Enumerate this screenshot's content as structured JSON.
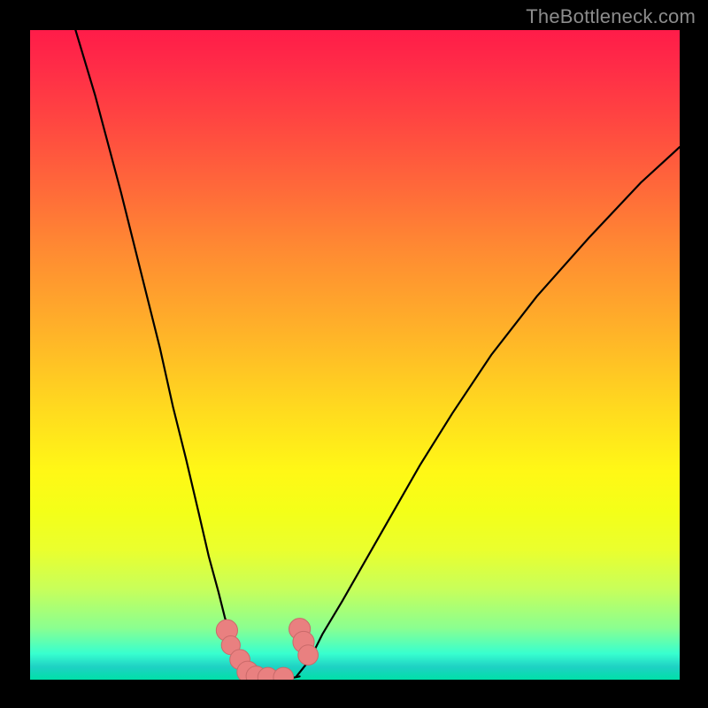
{
  "watermark": "TheBottleneck.com",
  "colors": {
    "frame": "#000000",
    "curve": "#000000",
    "dot_fill": "#e98080",
    "dot_stroke": "#ca6a6a"
  },
  "chart_data": {
    "type": "line",
    "title": "",
    "xlabel": "",
    "ylabel": "",
    "xlim": [
      0,
      100
    ],
    "ylim": [
      0,
      100
    ],
    "grid": false,
    "legend": false,
    "series": [
      {
        "name": "left-curve",
        "x": [
          7,
          10,
          14,
          17,
          20,
          22,
          24,
          26,
          27.5,
          29,
          30,
          31,
          32,
          33,
          34,
          35,
          36
        ],
        "y": [
          100,
          90,
          75,
          63,
          51,
          42,
          34,
          25.5,
          19,
          13.5,
          9.5,
          6.8,
          4.6,
          3.0,
          2.0,
          1.2,
          0.6
        ]
      },
      {
        "name": "right-curve",
        "x": [
          41,
          43,
          45,
          48,
          52,
          56,
          60,
          65,
          71,
          78,
          86,
          94,
          100
        ],
        "y": [
          0.5,
          3,
          7,
          12,
          19,
          26,
          33,
          41,
          50,
          59,
          68,
          76.5,
          82
        ]
      },
      {
        "name": "bottom-segment",
        "x": [
          32.5,
          34,
          36,
          38,
          40,
          41.5
        ],
        "y": [
          0.5,
          0.2,
          0.15,
          0.15,
          0.2,
          0.5
        ]
      }
    ],
    "markers": [
      {
        "x": 30.3,
        "y": 7.6,
        "r": 1.1
      },
      {
        "x": 30.9,
        "y": 5.3,
        "r": 0.9
      },
      {
        "x": 32.3,
        "y": 3.1,
        "r": 1.0
      },
      {
        "x": 33.5,
        "y": 1.2,
        "r": 1.1
      },
      {
        "x": 34.8,
        "y": 0.55,
        "r": 1.0
      },
      {
        "x": 36.6,
        "y": 0.35,
        "r": 1.0
      },
      {
        "x": 39.0,
        "y": 0.35,
        "r": 1.0
      },
      {
        "x": 41.5,
        "y": 7.8,
        "r": 1.1
      },
      {
        "x": 42.1,
        "y": 5.8,
        "r": 1.1
      },
      {
        "x": 42.8,
        "y": 3.8,
        "r": 1.0
      }
    ],
    "gradient_stops": [
      {
        "pct": 0,
        "color": "#ff1c49"
      },
      {
        "pct": 34,
        "color": "#ff8b32"
      },
      {
        "pct": 68,
        "color": "#fff816"
      },
      {
        "pct": 100,
        "color": "#00e0a8"
      }
    ]
  }
}
